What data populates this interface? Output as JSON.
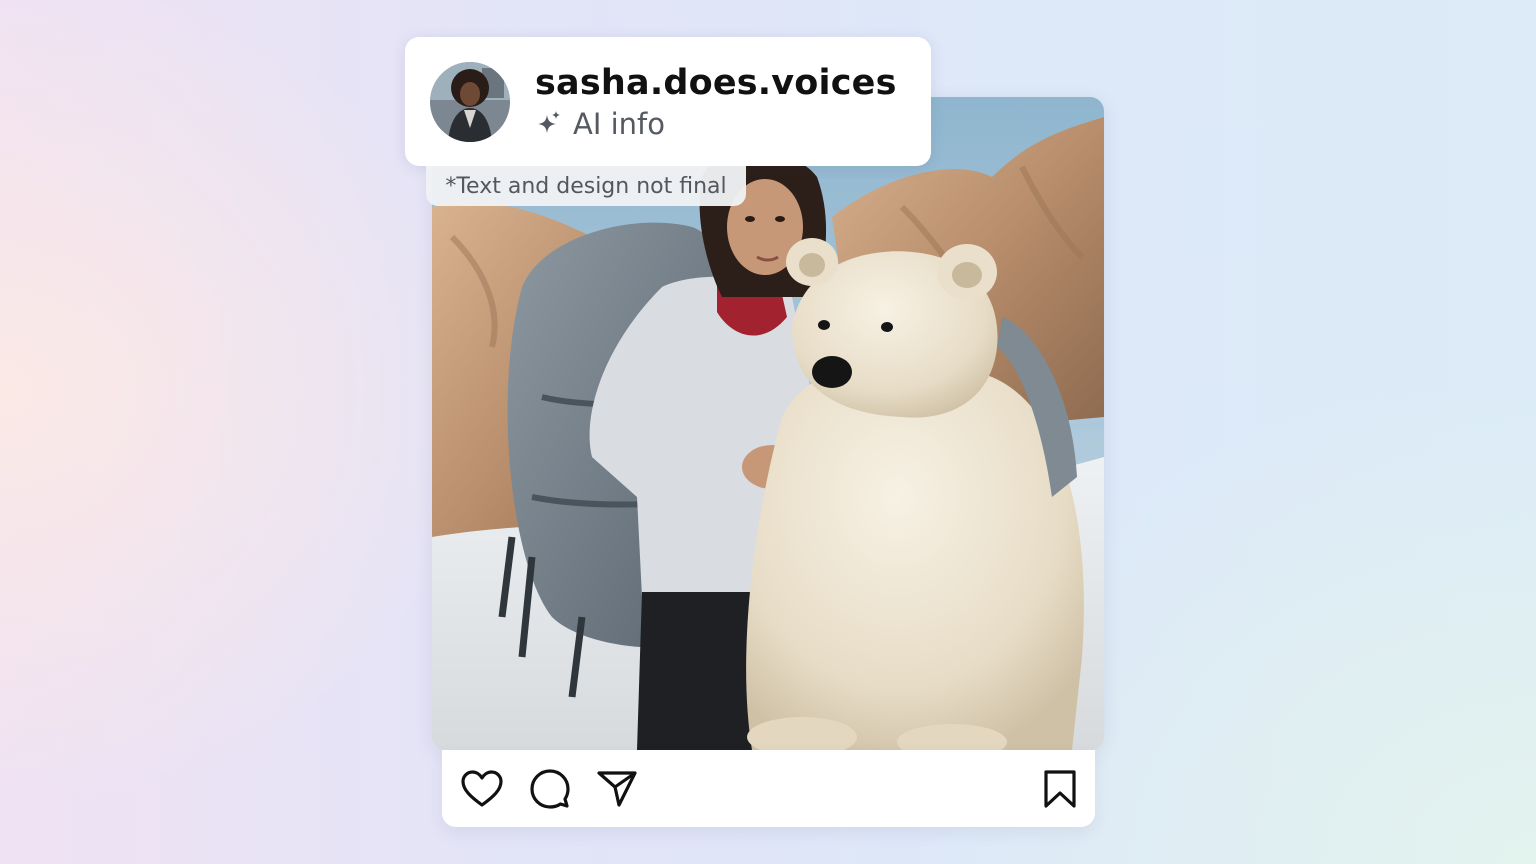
{
  "post": {
    "username": "sasha.does.voices",
    "ai_label": "AI info",
    "disclaimer": "*Text and design not final",
    "actions": {
      "like_icon": "heart-icon",
      "comment_icon": "comment-icon",
      "share_icon": "send-icon",
      "save_icon": "bookmark-icon"
    },
    "ai_icon": "sparkle-icon"
  },
  "colors": {
    "card_bg": "#ffffff",
    "username_text": "#111111",
    "secondary_text": "#555a62",
    "icon_stroke": "#111111"
  }
}
